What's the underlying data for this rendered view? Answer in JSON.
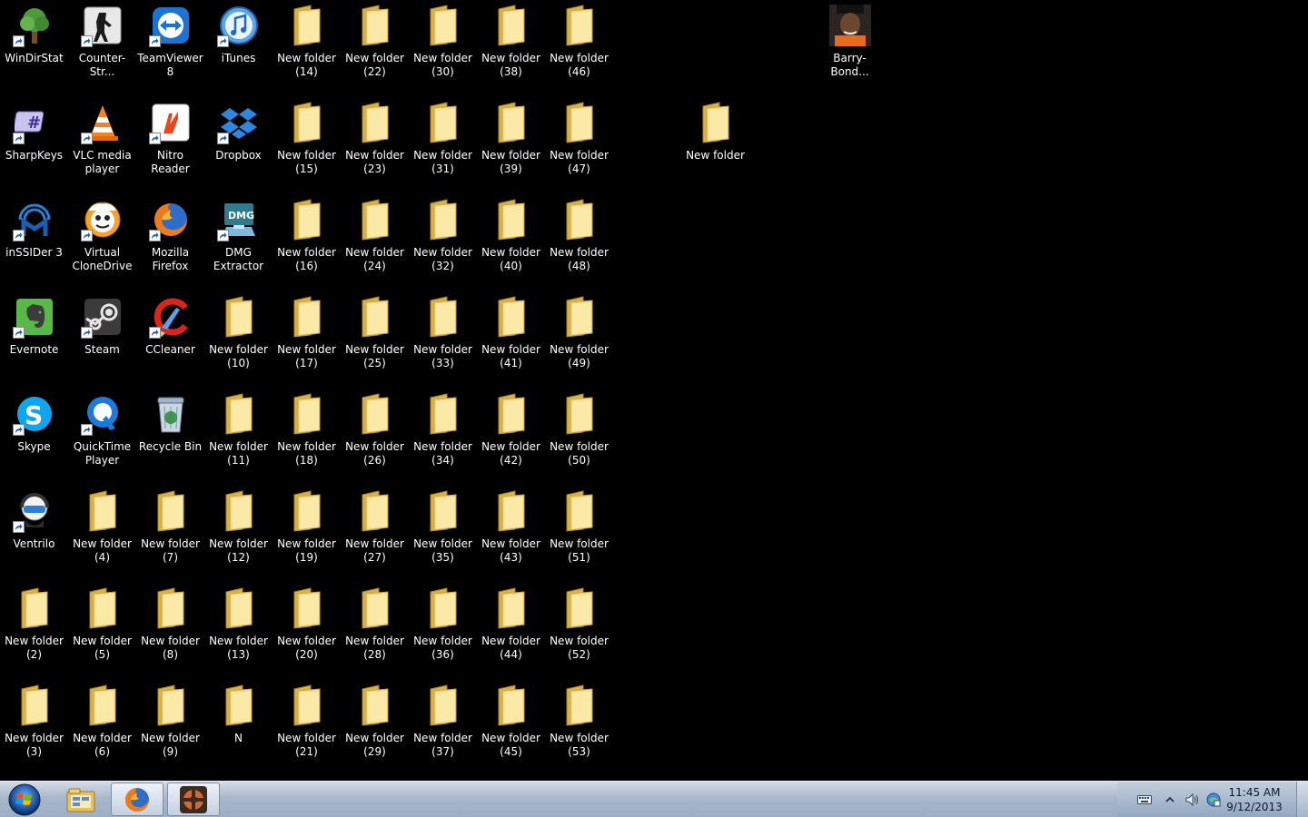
{
  "desktop": {
    "background": "#000000",
    "row1": [
      {
        "label": "WinDirStat",
        "icon": "windirstat-icon"
      },
      {
        "label": "Counter-Str...",
        "icon": "counter-strike-icon"
      },
      {
        "label": "TeamViewer\n8",
        "icon": "teamviewer-icon"
      },
      {
        "label": "iTunes",
        "icon": "itunes-icon"
      }
    ],
    "row2": [
      {
        "label": "SharpKeys",
        "icon": "sharpkeys-icon"
      },
      {
        "label": "VLC media\nplayer",
        "icon": "vlc-icon"
      },
      {
        "label": "Nitro Reader",
        "icon": "nitro-reader-icon"
      },
      {
        "label": "Dropbox",
        "icon": "dropbox-icon"
      }
    ],
    "row3": [
      {
        "label": "inSSIDer 3",
        "icon": "inssider-icon"
      },
      {
        "label": "Virtual\nCloneDrive",
        "icon": "virtual-clonedrive-icon"
      },
      {
        "label": "Mozilla\nFirefox",
        "icon": "firefox-icon"
      },
      {
        "label": "DMG\nExtractor",
        "icon": "dmg-extractor-icon"
      }
    ],
    "row4": [
      {
        "label": "Evernote",
        "icon": "evernote-icon"
      },
      {
        "label": "Steam",
        "icon": "steam-icon"
      },
      {
        "label": "CCleaner",
        "icon": "ccleaner-icon"
      }
    ],
    "row5": [
      {
        "label": "Skype",
        "icon": "skype-icon"
      },
      {
        "label": "QuickTime\nPlayer",
        "icon": "quicktime-icon"
      },
      {
        "label": "Recycle Bin",
        "icon": "recycle-bin-icon"
      }
    ],
    "row6": [
      {
        "label": "Ventrilo",
        "icon": "ventrilo-icon"
      }
    ],
    "folders": {
      "col1": [
        "New folder\n(2)",
        "New folder\n(3)"
      ],
      "col2": [
        "New folder\n(4)",
        "New folder\n(5)",
        "New folder\n(6)"
      ],
      "col3": [
        "New folder\n(7)",
        "New folder\n(8)",
        "New folder\n(9)"
      ],
      "col4": [
        "New folder\n(10)",
        "New folder\n(11)",
        "New folder\n(12)",
        "New folder\n(13)",
        "N"
      ],
      "col5": [
        "New folder\n(14)",
        "New folder\n(15)",
        "New folder\n(16)",
        "New folder\n(17)",
        "New folder\n(18)",
        "New folder\n(19)",
        "New folder\n(20)",
        "New folder\n(21)"
      ],
      "col6": [
        "New folder\n(22)",
        "New folder\n(23)",
        "New folder\n(24)",
        "New folder\n(25)",
        "New folder\n(26)",
        "New folder\n(27)",
        "New folder\n(28)",
        "New folder\n(29)"
      ],
      "col7": [
        "New folder\n(30)",
        "New folder\n(31)",
        "New folder\n(32)",
        "New folder\n(33)",
        "New folder\n(34)",
        "New folder\n(35)",
        "New folder\n(36)",
        "New folder\n(37)"
      ],
      "col8": [
        "New folder\n(38)",
        "New folder\n(39)",
        "New folder\n(40)",
        "New folder\n(41)",
        "New folder\n(42)",
        "New folder\n(43)",
        "New folder\n(44)",
        "New folder\n(45)"
      ],
      "col9": [
        "New folder\n(46)",
        "New folder\n(47)",
        "New folder\n(48)",
        "New folder\n(49)",
        "New folder\n(50)",
        "New folder\n(51)",
        "New folder\n(52)",
        "New folder\n(53)"
      ]
    },
    "extra_folder": "New folder",
    "photo_file": "Barry-Bond..."
  },
  "taskbar": {
    "pinned": [
      "windows-explorer-icon",
      "firefox-icon",
      "tf2-icon"
    ],
    "tray": [
      "keyboard-icon",
      "show-hidden-icons-chevron",
      "volume-icon",
      "network-icon"
    ],
    "time": "11:45 AM",
    "date": "9/12/2013"
  }
}
